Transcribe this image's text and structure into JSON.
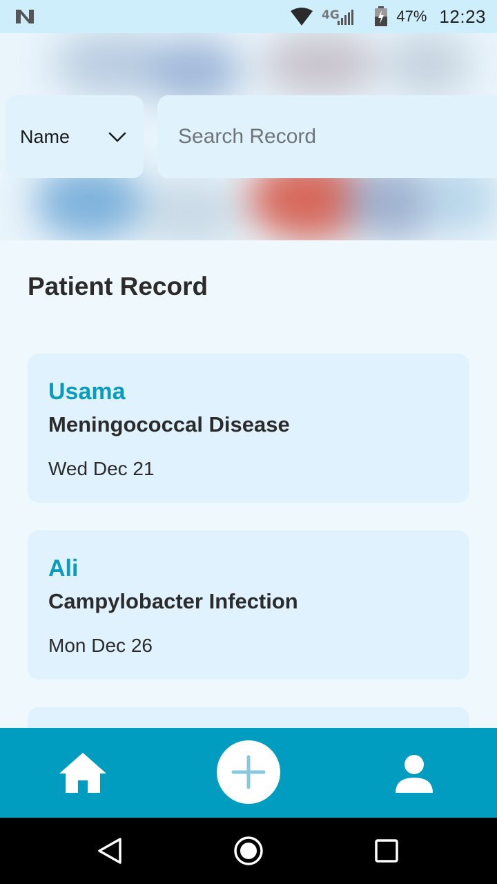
{
  "status_bar": {
    "network_label": "4G",
    "battery": "47%",
    "time": "12:23",
    "icons": [
      "n-logo-icon",
      "wifi-icon",
      "signal-icon",
      "battery-icon"
    ]
  },
  "search": {
    "filter_value": "Name",
    "placeholder": "Search Record"
  },
  "section_title": "Patient Record",
  "records": [
    {
      "name": "Usama",
      "disease": "Meningococcal Disease",
      "date": "Wed Dec 21"
    },
    {
      "name": "Ali",
      "disease": "Campylobacter Infection",
      "date": "Mon Dec 26"
    }
  ],
  "bottom_nav": {
    "items": [
      "home-icon",
      "add-icon",
      "profile-icon"
    ]
  },
  "colors": {
    "accent": "#009dc1",
    "name_text": "#0b9bbf",
    "card_bg": "#dff2fd",
    "page_bg": "#eff8fd"
  }
}
